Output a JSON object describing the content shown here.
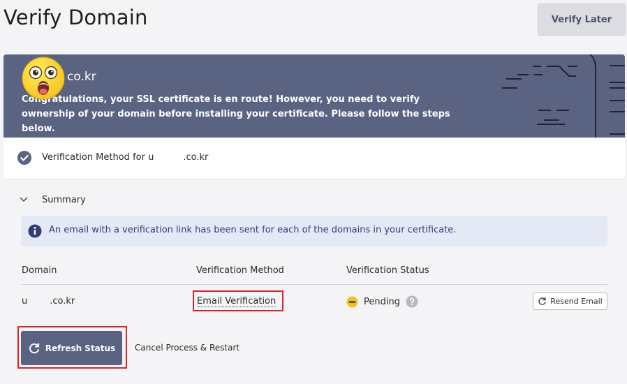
{
  "page": {
    "title": "Verify Domain",
    "verify_later_label": "Verify Later"
  },
  "banner": {
    "domain": "co.kr",
    "message": "Congratulations, your SSL certificate is en route! However, you need to verify ownership of your domain before installing your certificate. Please follow the steps below."
  },
  "method_row": {
    "label_prefix": "Verification Method for u",
    "label_suffix": ".co.kr"
  },
  "summary": {
    "label": "Summary",
    "info_text": "An email with a verification link has been sent for each of the domains in your certificate."
  },
  "table": {
    "headers": [
      "Domain",
      "Verification Method",
      "Verification Status"
    ],
    "rows": [
      {
        "domain_prefix": "u",
        "domain_suffix": ".co.kr",
        "method": "Email Verification",
        "status": "Pending",
        "action": "Resend Email"
      }
    ]
  },
  "actions": {
    "refresh_label": "Refresh Status",
    "cancel_label": "Cancel Process & Restart"
  },
  "colors": {
    "banner": "#5a6482",
    "primary_button": "#596381",
    "highlight": "#d9232e",
    "info_bg": "#e5e9f5",
    "pending": "#f0c419"
  },
  "icons": [
    "shock-face-emoji-icon",
    "check-circle-icon",
    "chevron-down-icon",
    "info-icon",
    "pending-icon",
    "help-icon",
    "refresh-icon"
  ]
}
